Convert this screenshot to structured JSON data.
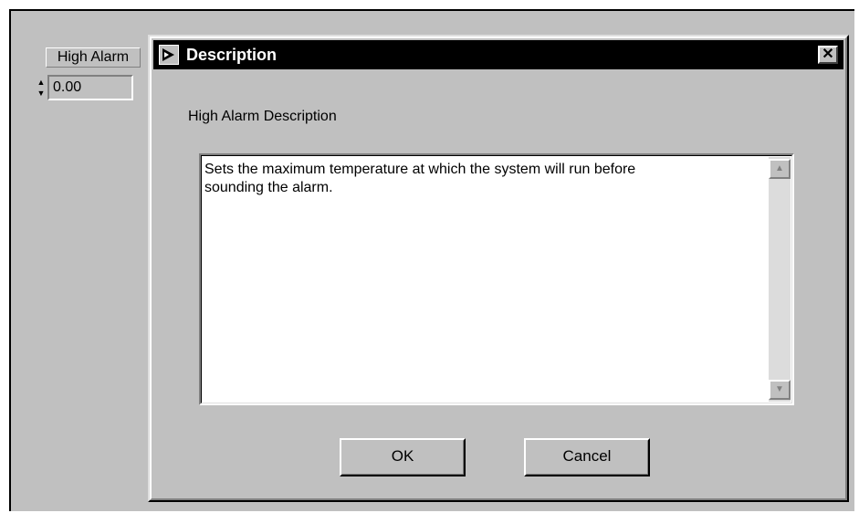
{
  "control": {
    "label": "High Alarm",
    "value": "0.00",
    "spin_up_icon": "up-arrow-icon",
    "spin_down_icon": "down-arrow-icon"
  },
  "dialog": {
    "title": "Description",
    "title_icon": "labview-vi-icon",
    "close_label": "✕",
    "subtitle": "High Alarm Description",
    "text": "Sets the maximum temperature at which the system will run before\nsounding the alarm.",
    "ok_label": "OK",
    "cancel_label": "Cancel",
    "scroll_up_icon": "▲",
    "scroll_down_icon": "▼"
  },
  "colors": {
    "panel": "#c0c0c0",
    "titlebar": "#000000",
    "title_text": "#ffffff"
  }
}
